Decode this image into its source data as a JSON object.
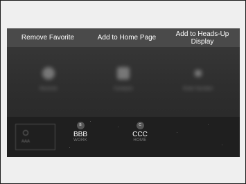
{
  "menu": {
    "items": [
      {
        "label": "Remove Favorite"
      },
      {
        "label": "Add to Home Page"
      },
      {
        "label": "Add to Heads-Up Display"
      }
    ]
  },
  "background_tiles": [
    {
      "label": "Recents"
    },
    {
      "label": "Contacts"
    },
    {
      "label": "Enter Number"
    }
  ],
  "favorites": {
    "placeholder": {
      "label": "AAA"
    },
    "items": [
      {
        "badge": "B",
        "name": "BBB",
        "subtitle": "WORK"
      },
      {
        "badge": "C",
        "name": "CCC",
        "subtitle": "HOME"
      }
    ]
  }
}
